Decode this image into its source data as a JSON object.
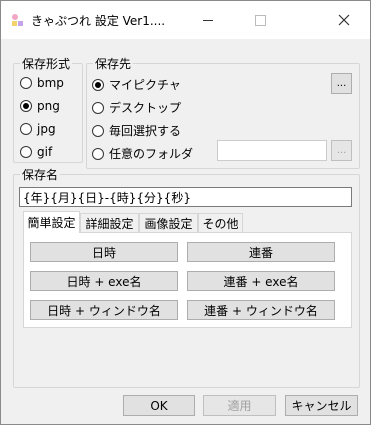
{
  "window": {
    "title": "きゃぷつれ 設定 Ver1....",
    "icon": "capture-app-icon"
  },
  "format_group": {
    "legend": "保存形式",
    "options": [
      "bmp",
      "png",
      "jpg",
      "gif"
    ],
    "selected": "png"
  },
  "dest_group": {
    "legend": "保存先",
    "options": [
      "マイピクチャ",
      "デスクトップ",
      "毎回選択する",
      "任意のフォルダ"
    ],
    "selected": "マイピクチャ",
    "browse_label": "...",
    "folder_browse_label": "...",
    "folder_value": ""
  },
  "name_group": {
    "legend": "保存名",
    "value": "{年}{月}{日}-{時}{分}{秒}",
    "tabs": [
      "簡単設定",
      "詳細設定",
      "画像設定",
      "その他"
    ],
    "active_tab": "簡単設定",
    "presets": [
      "日時",
      "連番",
      "日時 + exe名",
      "連番 + exe名",
      "日時 + ウィンドウ名",
      "連番 + ウィンドウ名"
    ]
  },
  "footer": {
    "ok": "OK",
    "apply": "適用",
    "cancel": "キャンセル"
  }
}
